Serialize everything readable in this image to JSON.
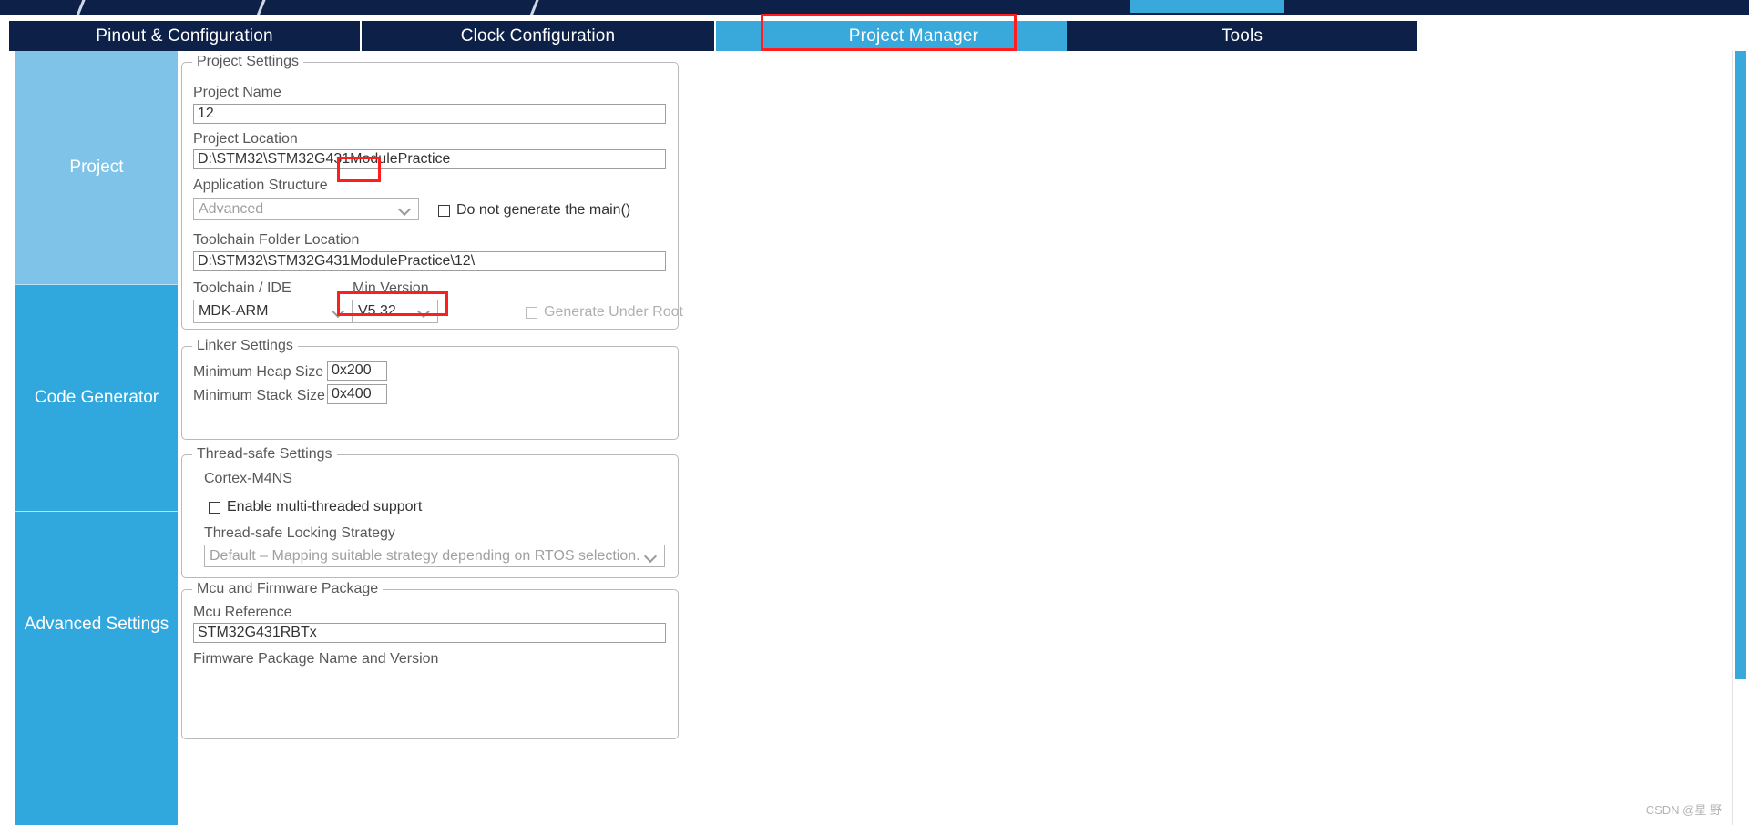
{
  "window": {
    "active_chip_color": "#39a9dc",
    "chrome_color": "#0d2148"
  },
  "tabs": [
    {
      "label": "Pinout & Configuration",
      "selected": false
    },
    {
      "label": "Clock Configuration",
      "selected": false
    },
    {
      "label": "Project Manager",
      "selected": true
    },
    {
      "label": "Tools",
      "selected": false
    }
  ],
  "sidebar": {
    "items": [
      {
        "label": "Project",
        "selected": true
      },
      {
        "label": "Code Generator",
        "selected": false
      },
      {
        "label": "Advanced Settings",
        "selected": false
      },
      {
        "label": "",
        "selected": false
      }
    ]
  },
  "project_settings": {
    "legend": "Project Settings",
    "project_name_label": "Project Name",
    "project_name_value": "12",
    "project_location_label": "Project Location",
    "project_location_value": "D:\\STM32\\STM32G431ModulePractice",
    "application_structure_label": "Application Structure",
    "application_structure_value": "Advanced",
    "do_not_generate_main_label": "Do not generate the main()",
    "do_not_generate_main_checked": false,
    "toolchain_folder_label": "Toolchain Folder Location",
    "toolchain_folder_value": "D:\\STM32\\STM32G431ModulePractice\\12\\",
    "toolchain_ide_label": "Toolchain / IDE",
    "toolchain_ide_value": "MDK-ARM",
    "min_version_label": "Min Version",
    "min_version_value": "V5.32",
    "generate_under_root_label": "Generate Under Root",
    "generate_under_root_checked": false
  },
  "linker_settings": {
    "legend": "Linker Settings",
    "min_heap_label": "Minimum Heap Size",
    "min_heap_value": "0x200",
    "min_stack_label": "Minimum Stack Size",
    "min_stack_value": "0x400"
  },
  "thread_safe_settings": {
    "legend": "Thread-safe Settings",
    "core_label": "Cortex-M4NS",
    "enable_multithread_label": "Enable multi-threaded support",
    "enable_multithread_checked": false,
    "locking_strategy_label": "Thread-safe Locking Strategy",
    "locking_strategy_value": "Default – Mapping suitable strategy depending on RTOS selection."
  },
  "mcu_firmware": {
    "legend": "Mcu and Firmware Package",
    "mcu_reference_label": "Mcu Reference",
    "mcu_reference_value": "STM32G431RBTx",
    "firmware_package_label": "Firmware Package Name and Version"
  },
  "watermark": "CSDN @星 野"
}
